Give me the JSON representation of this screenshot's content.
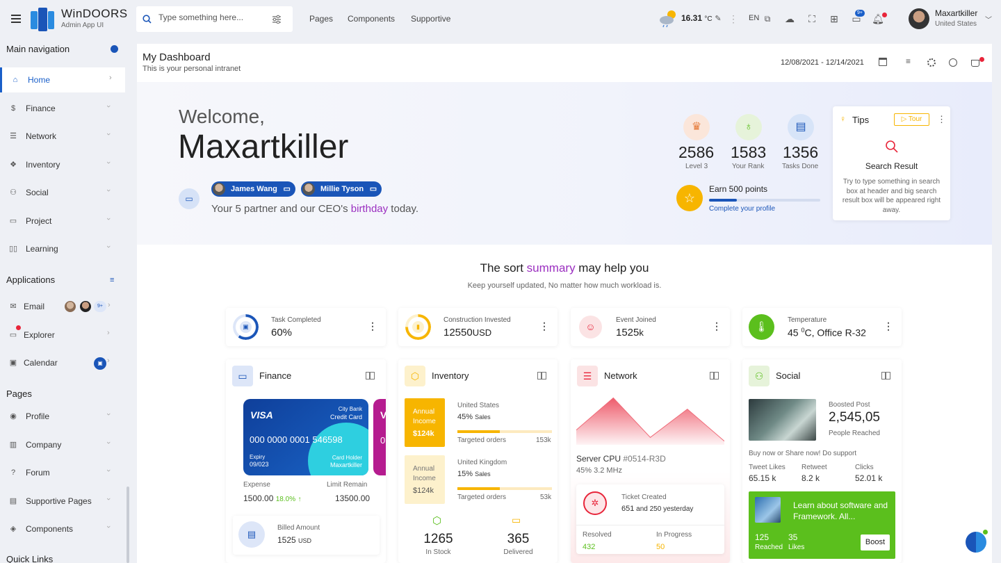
{
  "app": {
    "name": "WinDOORS",
    "subtitle": "Admin App UI"
  },
  "search": {
    "placeholder": "Type something here..."
  },
  "topnav": [
    "Pages",
    "Components",
    "Supportive"
  ],
  "weather": {
    "temp": "16.31",
    "unit": "°C"
  },
  "lang": "EN",
  "chat_badge": "9+",
  "user": {
    "name": "Maxartkiller",
    "country": "United States"
  },
  "sidebar": {
    "main_title": "Main navigation",
    "main": [
      "Home",
      "Finance",
      "Network",
      "Inventory",
      "Social",
      "Project",
      "Learning"
    ],
    "apps_title": "Applications",
    "apps": [
      "Email",
      "Explorer",
      "Calendar"
    ],
    "email_badge": "9+",
    "pages_title": "Pages",
    "pages": [
      "Profile",
      "Company",
      "Forum",
      "Supportive Pages",
      "Components"
    ],
    "quick_title": "Quick Links"
  },
  "dashboard": {
    "title": "My Dashboard",
    "subtitle": "This is your personal intranet",
    "date_range": "12/08/2021 - 12/14/2021"
  },
  "hero": {
    "welcome": "Welcome,",
    "name": "Maxartkiller",
    "partners": [
      "James Wang",
      "Millie Tyson"
    ],
    "msg_pre": "Your 5 partner and our CEO's ",
    "msg_hl": "birthday",
    "msg_post": " today.",
    "stats": [
      {
        "value": "2586",
        "label": "Level 3"
      },
      {
        "value": "1583",
        "label": "Your Rank"
      },
      {
        "value": "1356",
        "label": "Tasks Done"
      }
    ],
    "points": "Earn 500 points",
    "points_progress": 0.25,
    "profile_link": "Complete your profile"
  },
  "tips": {
    "title": "Tips",
    "tour": "Tour",
    "heading": "Search Result",
    "body": "Try to type something in search box at header and big search result box will be appeared right away."
  },
  "summary": {
    "pre": "The sort ",
    "hl": "summary",
    "post": " may help you",
    "sub": "Keep yourself updated, No matter how much workload is."
  },
  "mini_cards": [
    {
      "title": "Task Completed",
      "value": "60%",
      "unit": "",
      "progress": 0.6
    },
    {
      "title": "Construction Invested",
      "value": "12550",
      "unit": "USD",
      "progress": 0.75
    },
    {
      "title": "Event Joined",
      "value": "1525",
      "unit": "k"
    },
    {
      "title": "Temperature",
      "value": "45 ",
      "sup": "0",
      "unit": "C, Office R-32"
    }
  ],
  "finance": {
    "title": "Finance",
    "card": {
      "brand": "VISA",
      "bank": "City Bank",
      "type": "Credit Card",
      "number": "000 0000 0001 546598",
      "expiry_label": "Expiry",
      "expiry": "09/023",
      "holder_label": "Card Holder",
      "holder": "Maxartkiller"
    },
    "expense_label": "Expense",
    "expense": "1500.00",
    "expense_change": "18.0%",
    "limit_label": "Limit Remain",
    "limit": "13500.00",
    "billed_label": "Billed Amount",
    "billed": "1525",
    "billed_unit": "USD"
  },
  "inventory": {
    "title": "Inventory",
    "rows": [
      {
        "label": "Annual Income",
        "amount": "$124k",
        "country": "United States",
        "sales": "45%",
        "sales_label": "Sales",
        "orders_label": "Targeted orders",
        "orders": "153k",
        "progress": 0.45
      },
      {
        "label": "Annual Income",
        "amount": "$124k",
        "country": "United Kingdom",
        "sales": "15%",
        "sales_label": "Sales",
        "orders_label": "Targeted orders",
        "orders": "53k",
        "progress": 0.45
      }
    ],
    "in_stock": "1265",
    "in_stock_label": "In Stock",
    "delivered": "365",
    "delivered_label": "Delivered"
  },
  "network": {
    "title": "Network",
    "chart_data": {
      "type": "area",
      "values": [
        20,
        63,
        10,
        48,
        5
      ],
      "ylim": [
        0,
        70
      ]
    },
    "server": "Server CPU ",
    "server_id": "#0514-R3D",
    "cpu": "45% 3.2 MHz",
    "ticket_label": "Ticket Created",
    "ticket_value": "651",
    "ticket_rest": " and 250 yesterday",
    "resolved_label": "Resolved",
    "resolved": "432",
    "inprogress_label": "In Progress",
    "inprogress": "50"
  },
  "social": {
    "title": "Social",
    "boosted_label": "Boosted Post",
    "boosted": "2,545,05",
    "reached_label": "People Reached",
    "cta": "Buy now or Share now! Do support",
    "metrics": [
      {
        "label": "Tweet Likes",
        "value": "65.15 k"
      },
      {
        "label": "Retweet",
        "value": "8.2 k"
      },
      {
        "label": "Clicks",
        "value": "52.01 k"
      }
    ],
    "promo": "Learn about software and Framework. All...",
    "promo_reached": "125",
    "promo_reached_label": "Reached",
    "promo_likes": "35",
    "promo_likes_label": "Likes",
    "boost": "Boost"
  },
  "colors": {
    "primary": "#1a55b8",
    "purple": "#9b2fc0",
    "yellow": "#f7b500",
    "red": "#e8253a",
    "green": "#5bbf1d"
  }
}
